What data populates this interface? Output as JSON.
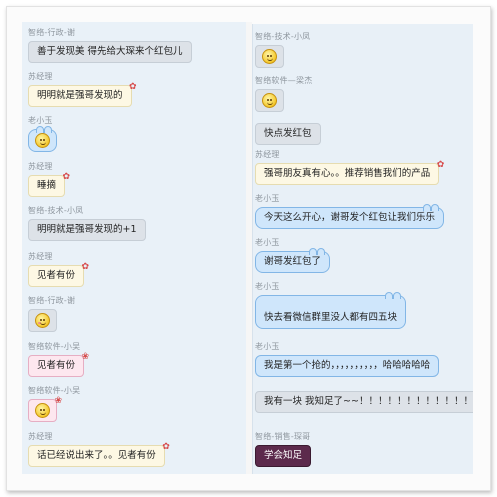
{
  "left_panel": {
    "messages": [
      {
        "sender": "智络-行政-谢",
        "text": "善于发现美  得先给大琛来个红包儿",
        "style": "gray"
      },
      {
        "sender": "苏经理",
        "text": "明明就是强哥发现的",
        "style": "cream"
      },
      {
        "sender": "老小玉",
        "text": "",
        "style": "blue-emoji",
        "icon": "grin-emoji-icon"
      },
      {
        "sender": "苏经理",
        "text": "睡摘",
        "style": "cream"
      },
      {
        "sender": "智络-技术-小凤",
        "text": "明明就是强哥发现的+1",
        "style": "gray"
      },
      {
        "sender": "苏经理",
        "text": "见者有份",
        "style": "cream"
      },
      {
        "sender": "智络-行政-谢",
        "text": "",
        "style": "gray-emoji",
        "icon": "wink-emoji-icon"
      },
      {
        "sender": "智络软件-小吴",
        "text": "见者有份",
        "style": "pink"
      },
      {
        "sender": "智络软件-小吴",
        "text": "",
        "style": "pink-emoji",
        "icon": "tongue-emoji-icon"
      },
      {
        "sender": "苏经理",
        "text": "话已经说出来了。。见者有份",
        "style": "cream"
      }
    ]
  },
  "right_panel": {
    "messages": [
      {
        "sender": "智络-技术-小凤",
        "text": "",
        "style": "gray-emoji",
        "icon": "tongue-emoji-icon"
      },
      {
        "sender": "智络软件—梁杰",
        "text": "",
        "style": "gray-emoji",
        "icon": "laugh-emoji-icon"
      },
      {
        "sender": "",
        "text": "快点发红包",
        "style": "gray"
      },
      {
        "sender": "苏经理",
        "text": "强哥朋友真有心。。推荐销售我们的产品",
        "style": "cream"
      },
      {
        "sender": "老小玉",
        "text": "今天这么开心，谢哥发个红包让我们乐乐",
        "style": "blue"
      },
      {
        "sender": "老小玉",
        "text": "谢哥发红包了",
        "style": "blue"
      },
      {
        "sender": "老小玉",
        "text": "快去看微信群里没人都有四五块",
        "style": "blue-tall"
      },
      {
        "sender": "老小玉",
        "text": "我是第一个抢的，，，，，，，，，，哈哈哈哈哈",
        "style": "blue"
      },
      {
        "sender": "",
        "text": "我有一块 我知足了~~！！！！！！！！！！！！",
        "style": "gray"
      },
      {
        "sender": "智络-销售-琛哥",
        "text": "学会知足",
        "style": "dark"
      }
    ]
  }
}
